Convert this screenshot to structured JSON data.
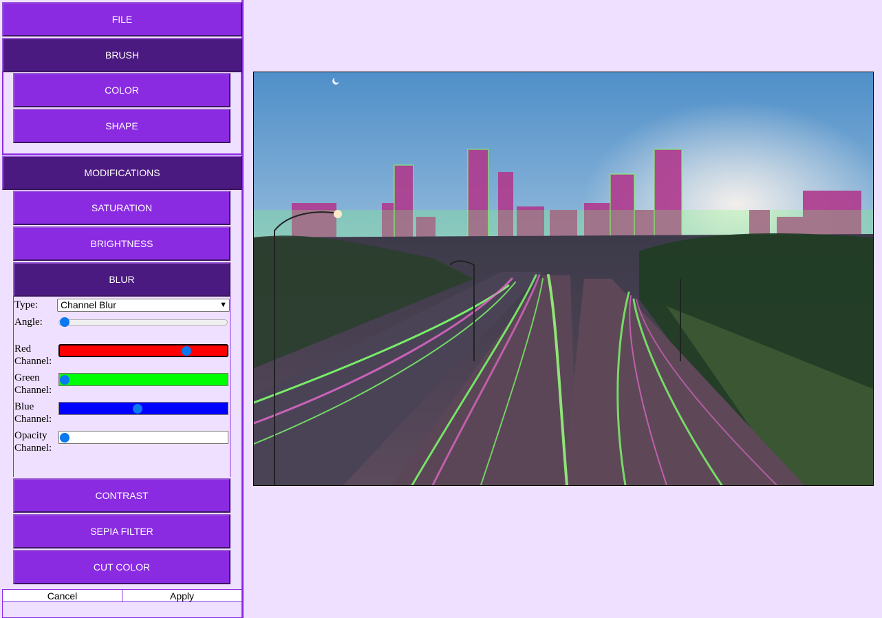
{
  "menu": {
    "file": "FILE",
    "brush": "BRUSH",
    "brush_items": [
      "COLOR",
      "SHAPE"
    ],
    "modifications": "MODIFICATIONS",
    "mod_items": {
      "saturation": "SATURATION",
      "brightness": "BRIGHTNESS",
      "blur": "BLUR",
      "contrast": "CONTRAST",
      "sepia": "SEPIA FILTER",
      "cut_color": "CUT COLOR"
    }
  },
  "blur_panel": {
    "type_label": "Type:",
    "type_value": "Channel Blur",
    "angle_label": "Angle:",
    "angle_value": 0,
    "red_label_1": "Red",
    "red_label_2": "Channel:",
    "red_value": 0.77,
    "green_label_1": "Green",
    "green_label_2": "Channel:",
    "green_value": 0,
    "blue_label_1": "Blue",
    "blue_label_2": "Channel:",
    "blue_value": 0.46,
    "opacity_label_1": "Opacity",
    "opacity_label_2": "Channel:",
    "opacity_value": 0
  },
  "actions": {
    "cancel": "Cancel",
    "apply": "Apply"
  },
  "colors": {
    "accent": "#8a2be2",
    "accent_dark": "#4b1a80",
    "background": "#f0e0ff",
    "slider_thumb": "#0a78f0",
    "red_track": "#ff0000",
    "green_track": "#00ff00",
    "blue_track": "#0000ff"
  }
}
